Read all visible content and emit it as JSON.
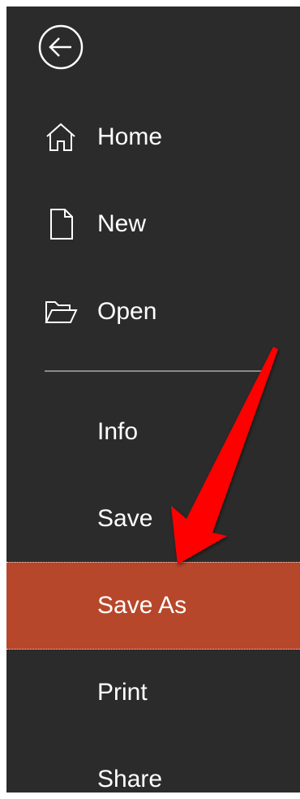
{
  "backstage": {
    "back_button": {
      "icon": "back-arrow-circle-icon"
    },
    "items": [
      {
        "label": "Home",
        "icon": "home-icon"
      },
      {
        "label": "New",
        "icon": "new-document-icon"
      },
      {
        "label": "Open",
        "icon": "open-folder-icon"
      },
      {
        "label": "Info"
      },
      {
        "label": "Save"
      },
      {
        "label": "Save As",
        "selected": true
      },
      {
        "label": "Print"
      },
      {
        "label": "Share"
      }
    ]
  },
  "colors": {
    "panel_background": "#2b2b2b",
    "selected_background": "#b7472a",
    "text": "#ffffff",
    "annotation_arrow": "#ff0000"
  }
}
